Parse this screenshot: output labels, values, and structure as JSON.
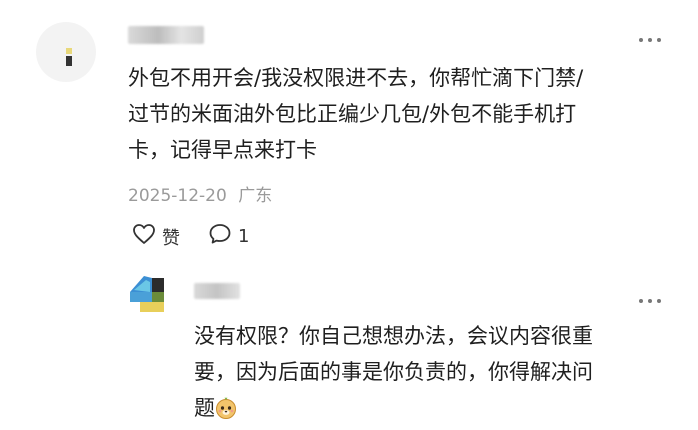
{
  "comment": {
    "username": "",
    "text": "外包不用开会/我没权限进不去，你帮忙滴下门禁/过节的米面油外包比正编少几包/外包不能手机打卡，记得早点来打卡",
    "line1": "外包不用开会/我没权限进不去，你帮忙滴下门禁/",
    "line2": "过节的米面油外包比正编少几包/外包不能手机打",
    "line3": "卡，记得早点来打卡",
    "date": "2025-12-20",
    "location": "广东",
    "like_label": "赞",
    "reply_count": "1",
    "more_label": "⋮"
  },
  "reply": {
    "username": "",
    "line1": "没有权限？你自己想想办法，会议内容很重",
    "line2": "要，因为后面的事是你负责的，你得解决问",
    "line3": "题",
    "more_label": "⋮"
  }
}
